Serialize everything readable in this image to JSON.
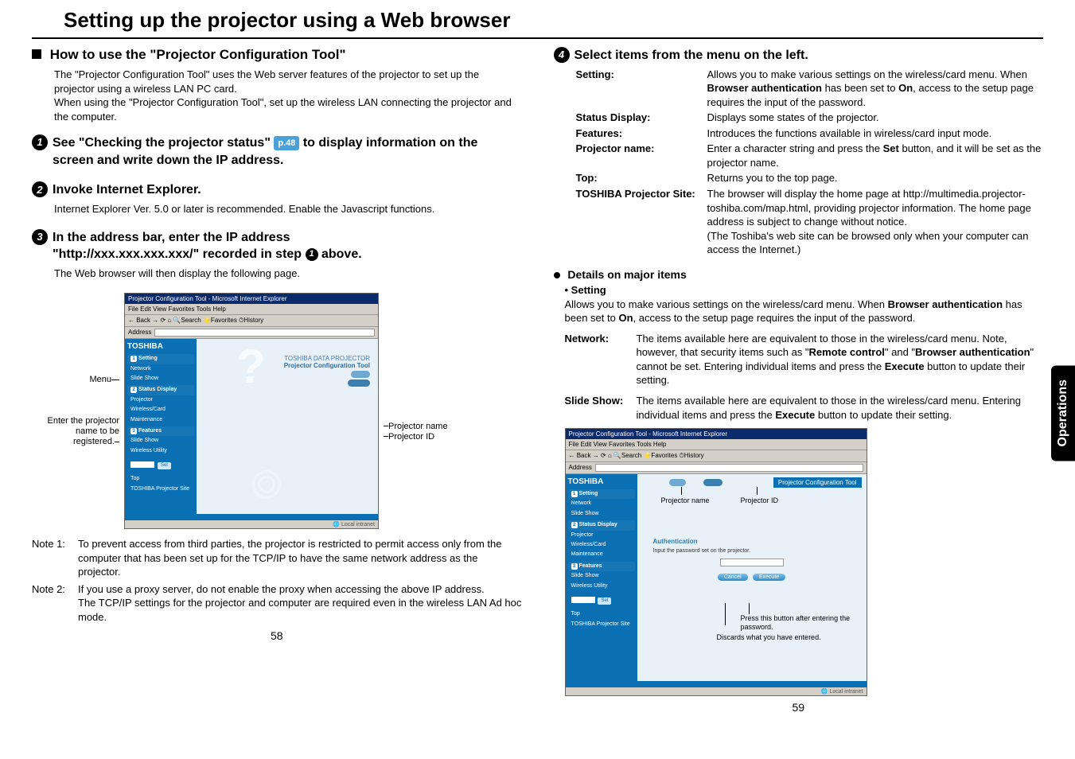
{
  "title": "Setting up the projector using a Web browser",
  "left": {
    "heading1": "How to use the \"Projector Configuration Tool\"",
    "intro_line1": "The \"Projector Configuration Tool\" uses the Web server features of the projector to set up the projector using a wireless LAN PC card.",
    "intro_line2": "When using the \"Projector Configuration Tool\", set up the wireless LAN connecting the projector and the computer.",
    "step1_pre": "See \"Checking the projector status\" ",
    "step1_ref": "p.48",
    "step1_post": " to display information on the screen and write down the IP address.",
    "step2_heading": "Invoke Internet Explorer.",
    "step2_body": "Internet Explorer Ver. 5.0 or later is recommended. Enable the Javascript functions.",
    "step3_line1": "In the address bar, enter the IP address",
    "step3_line2_pre": "\"http://xxx.xxx.xxx.xxx/\" recorded in step ",
    "step3_line2_post": " above.",
    "step3_body": "The Web browser will then display the following page.",
    "fig1": {
      "label_menu": "Menu",
      "label_register": "Enter the projector name to be registered.",
      "label_pjname": "Projector name",
      "label_pjid": "Projector ID",
      "browser_title": "Projector Configuration Tool - Microsoft Internet Explorer",
      "browser_menu": "File  Edit  View  Favorites  Tools  Help",
      "browser_toolbar": "← Back  →  ⟳  ⌂  🔍Search  ⭐Favorites  ⏱History",
      "browser_address_label": "Address",
      "brand": "TOSHIBA",
      "sb_setting": "Setting",
      "sb_network": "Network",
      "sb_slideshow": "Slide Show",
      "sb_status": "Status Display",
      "sb_projector": "Projector",
      "sb_wireless": "Wireless/Card",
      "sb_maint": "Maintenance",
      "sb_features": "Features",
      "sb_wutil": "Wireless Utility",
      "sb_top": "Top",
      "sb_site": "TOSHIBA Projector Site",
      "sb_set_btn": "Set",
      "main_title1": "TOSHIBA DATA PROJECTOR",
      "main_title2": "Projector Configuration Tool",
      "status_text": "Local intranet"
    },
    "note1_label": "Note 1:",
    "note1_body": "To prevent access from third parties, the projector is restricted to permit access only from the computer that has been set up for the TCP/IP to have the same network address as the projector.",
    "note2_label": "Note 2:",
    "note2_body": "If you use a proxy server, do not enable the proxy when accessing the above IP address.",
    "note2_extra": "The TCP/IP settings for the projector and computer are required even in the wireless LAN Ad hoc mode.",
    "page_num": "58"
  },
  "right": {
    "step4_heading": "Select items from the menu on the left.",
    "menu_items": {
      "setting_label": "Setting:",
      "setting_desc_pre": "Allows you to make various settings on the wireless/card menu. When ",
      "setting_desc_b1": "Browser authentication",
      "setting_desc_mid": " has been set to ",
      "setting_desc_b2": "On",
      "setting_desc_post": ", access to the setup page requires the input of the password.",
      "status_label": "Status Display:",
      "status_desc": "Displays some states of the projector.",
      "features_label": "Features:",
      "features_desc": "Introduces the functions available in wireless/card input mode.",
      "pjname_label": "Projector name:",
      "pjname_desc_pre": "Enter a character string and press the ",
      "pjname_desc_b": "Set",
      "pjname_desc_post": " button, and it will be set as the projector name.",
      "top_label": "Top:",
      "top_desc": "Returns you to the top page.",
      "site_label": "TOSHIBA Projector Site:",
      "site_desc": "The browser will display the home page at http://multimedia.projector-toshiba.com/map.html, providing projector information. The home page address is subject to change without notice.",
      "site_note": "(The Toshiba's web site can be browsed only when your computer can access the Internet.)"
    },
    "details_heading": "Details on major items",
    "setting_sub_heading": "Setting",
    "setting_sub_pre": "Allows you to make various settings on the wireless/card menu. When ",
    "setting_sub_b1": "Browser authentication",
    "setting_sub_mid": " has been set to ",
    "setting_sub_b2": "On",
    "setting_sub_post": ", access to the setup page requires the input of the password.",
    "network_label": "Network:",
    "network_desc_pre": "The items available here are equivalent to those in the wireless/card menu. Note, however, that security items such as \"",
    "network_desc_b1": "Remote control",
    "network_desc_mid": "\" and \"",
    "network_desc_b2": "Browser authentication",
    "network_desc_mid2": "\" cannot be set. Entering individual items and press the ",
    "network_desc_b3": "Execute",
    "network_desc_post": " button to update their setting.",
    "slideshow_label": "Slide Show:",
    "slideshow_desc_pre": "The items available here are equivalent to those in the wireless/card menu. Entering individual items and press the ",
    "slideshow_desc_b": "Execute",
    "slideshow_desc_post": " button to update their setting.",
    "fig2": {
      "label_pjname": "Projector name",
      "label_pjid": "Projector ID",
      "auth_title": "Authentication",
      "auth_hint": "Input the password set on the projector.",
      "btn_cancel": "Cancel",
      "btn_execute": "Execute",
      "label_exec": "Press this button after entering the password.",
      "label_cancel": "Discards what you have entered."
    },
    "side_tab": "Operations",
    "page_num": "59"
  }
}
